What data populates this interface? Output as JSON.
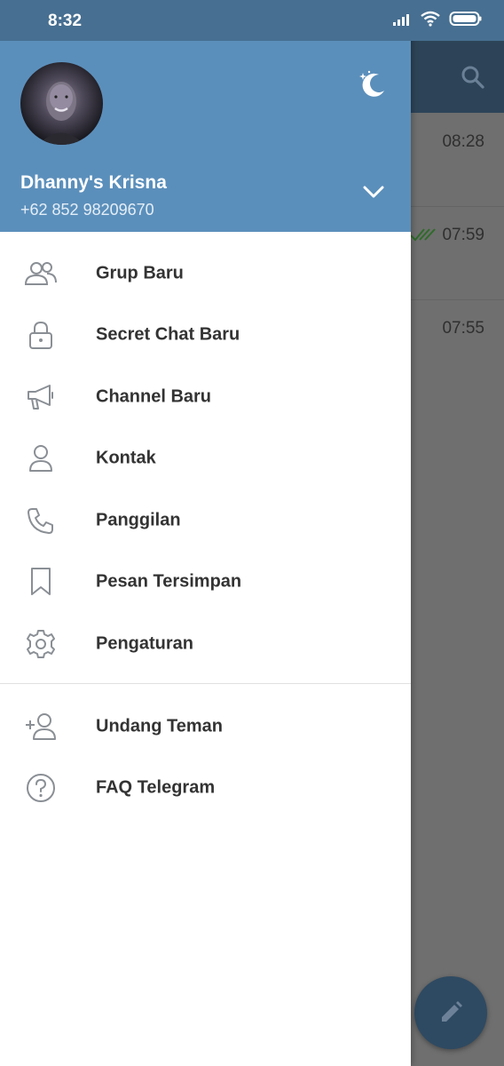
{
  "status_bar": {
    "time": "8:32",
    "icons": [
      "signal-icon",
      "wifi-icon",
      "battery-icon"
    ]
  },
  "background_chats": [
    {
      "time": "08:28",
      "read_checks": false
    },
    {
      "time": "07:59",
      "read_checks": true
    },
    {
      "time": "07:55",
      "read_checks": false
    }
  ],
  "drawer": {
    "header": {
      "name": "Dhanny's Krisna",
      "phone": "+62 852 98209670",
      "night_mode_icon": "moon-icon",
      "expand_icon": "chevron-down-icon"
    },
    "menu_items": [
      {
        "label": "Grup Baru",
        "icon": "new-group-icon"
      },
      {
        "label": "Secret Chat Baru",
        "icon": "lock-icon"
      },
      {
        "label": "Channel Baru",
        "icon": "megaphone-icon"
      },
      {
        "label": "Kontak",
        "icon": "person-icon"
      },
      {
        "label": "Panggilan",
        "icon": "phone-icon"
      },
      {
        "label": "Pesan Tersimpan",
        "icon": "bookmark-icon"
      },
      {
        "label": "Pengaturan",
        "icon": "gear-icon"
      }
    ],
    "secondary_items": [
      {
        "label": "Undang Teman",
        "icon": "add-person-icon"
      },
      {
        "label": "FAQ Telegram",
        "icon": "question-icon"
      }
    ]
  },
  "colors": {
    "header_bg": "#5b8fbb",
    "status_bar_bg": "#476f91",
    "menu_icon": "#8a8f95",
    "menu_text": "#333333",
    "fab_bg": "#2e4a62"
  }
}
